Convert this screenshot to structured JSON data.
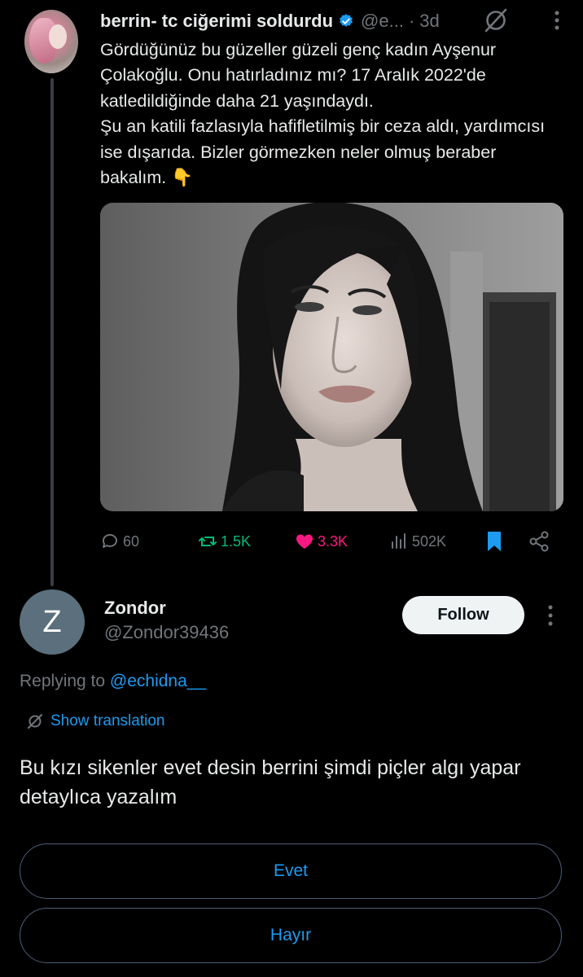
{
  "parent_tweet": {
    "display_name": "berrin- tc ciğerimi soldurdu",
    "handle": "@e...",
    "time": "3d",
    "text": "Gördüğünüz bu güzeller güzeli genç kadın Ayşenur Çolakoğlu. Onu hatırladınız mı? 17 Aralık 2022'de katledildiğinde daha 21 yaşındaydı.\nŞu an katili fazlasıyla hafifletilmiş bir ceza aldı, yardımcısı ise dışarıda. Bizler görmezken neler olmuş beraber bakalım. 👇",
    "stats": {
      "replies": "60",
      "reposts": "1.5K",
      "likes": "3.3K",
      "views": "502K"
    }
  },
  "reply": {
    "avatar_letter": "Z",
    "display_name": "Zondor",
    "handle": "@Zondor39436",
    "follow_label": "Follow",
    "replying_prefix": "Replying to ",
    "replying_handle": "@echidna__",
    "translation_label": "Show translation",
    "text": "Bu kızı sikenler evet desin berrini şimdi piçler algı yapar detaylıca yazalım",
    "poll_options": [
      "Evet",
      "Hayır"
    ]
  },
  "colors": {
    "background": "#000000",
    "text": "#e7e9ea",
    "muted": "#71767b",
    "accent": "#1d9bf0",
    "repost": "#00ba7c",
    "like": "#f91880"
  },
  "icons": [
    "verified-badge-icon",
    "grok-icon",
    "more-icon",
    "reply-icon",
    "repost-icon",
    "like-icon",
    "views-icon",
    "bookmark-icon",
    "share-icon",
    "translate-icon"
  ]
}
